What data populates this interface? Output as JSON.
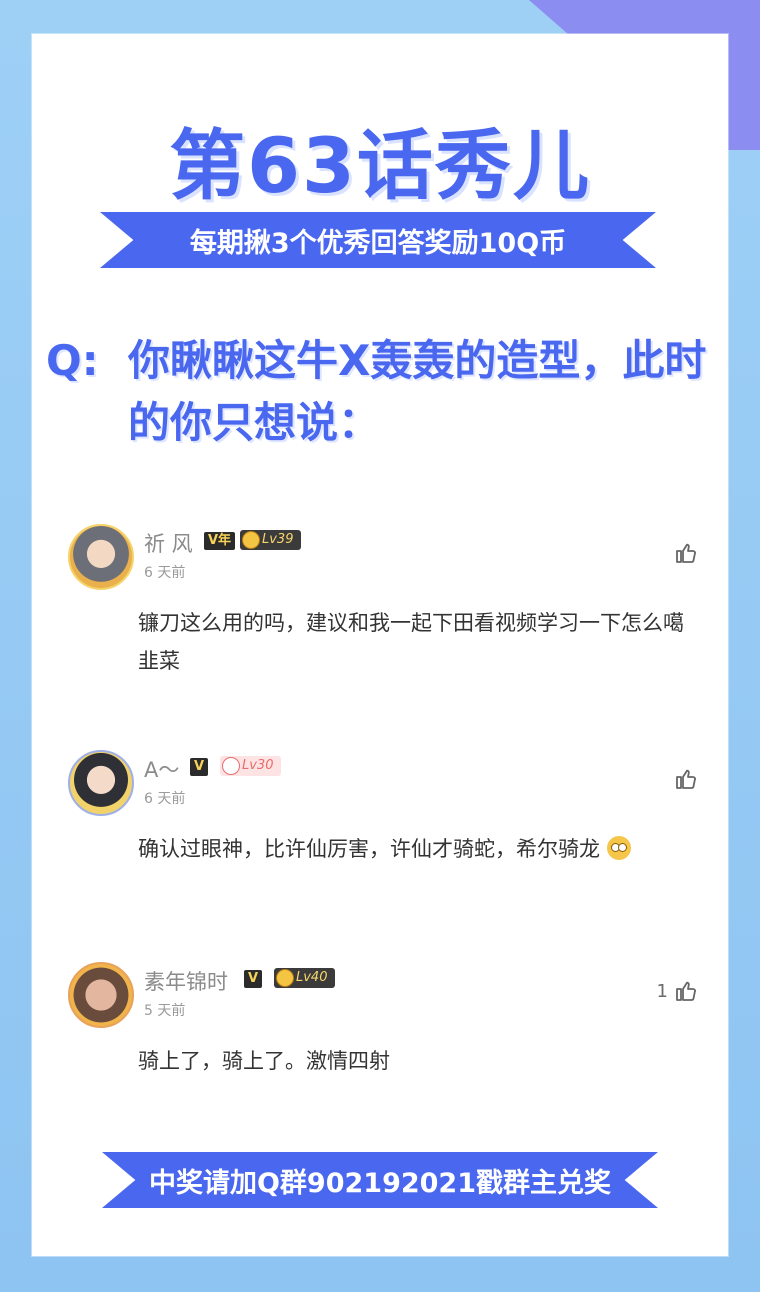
{
  "header": {
    "title": "第63话秀儿",
    "banner_top": "每期揪3个优秀回答奖励10Q币"
  },
  "question": {
    "prefix": "Q:",
    "text": "你瞅瞅这牛X轰轰的造型，此时的你只想说："
  },
  "comments": [
    {
      "name": "祈 风",
      "vip_label": "V年",
      "level": "Lv39",
      "time": "6 天前",
      "likes": "",
      "text": "镰刀这么用的吗，建议和我一起下田看视频学习一下怎么噶韭菜"
    },
    {
      "name": "A～",
      "vip_label": "V",
      "level": "Lv30",
      "time": "6 天前",
      "likes": "",
      "text": "确认过眼神，比许仙厉害，许仙才骑蛇，希尔骑龙"
    },
    {
      "name": "素年锦时",
      "vip_label": "V",
      "level": "Lv40",
      "time": "5 天前",
      "likes": "1",
      "text": "骑上了，骑上了。激情四射"
    }
  ],
  "footer": {
    "banner_bottom": "中奖请加Q群902192021戳群主兑奖"
  },
  "icons": {
    "like": "thumbs-up-icon",
    "emoji": "shocked-emoji-icon"
  },
  "colors": {
    "accent": "#4a67f0",
    "background": "#9ed0f6",
    "card": "#ffffff"
  }
}
